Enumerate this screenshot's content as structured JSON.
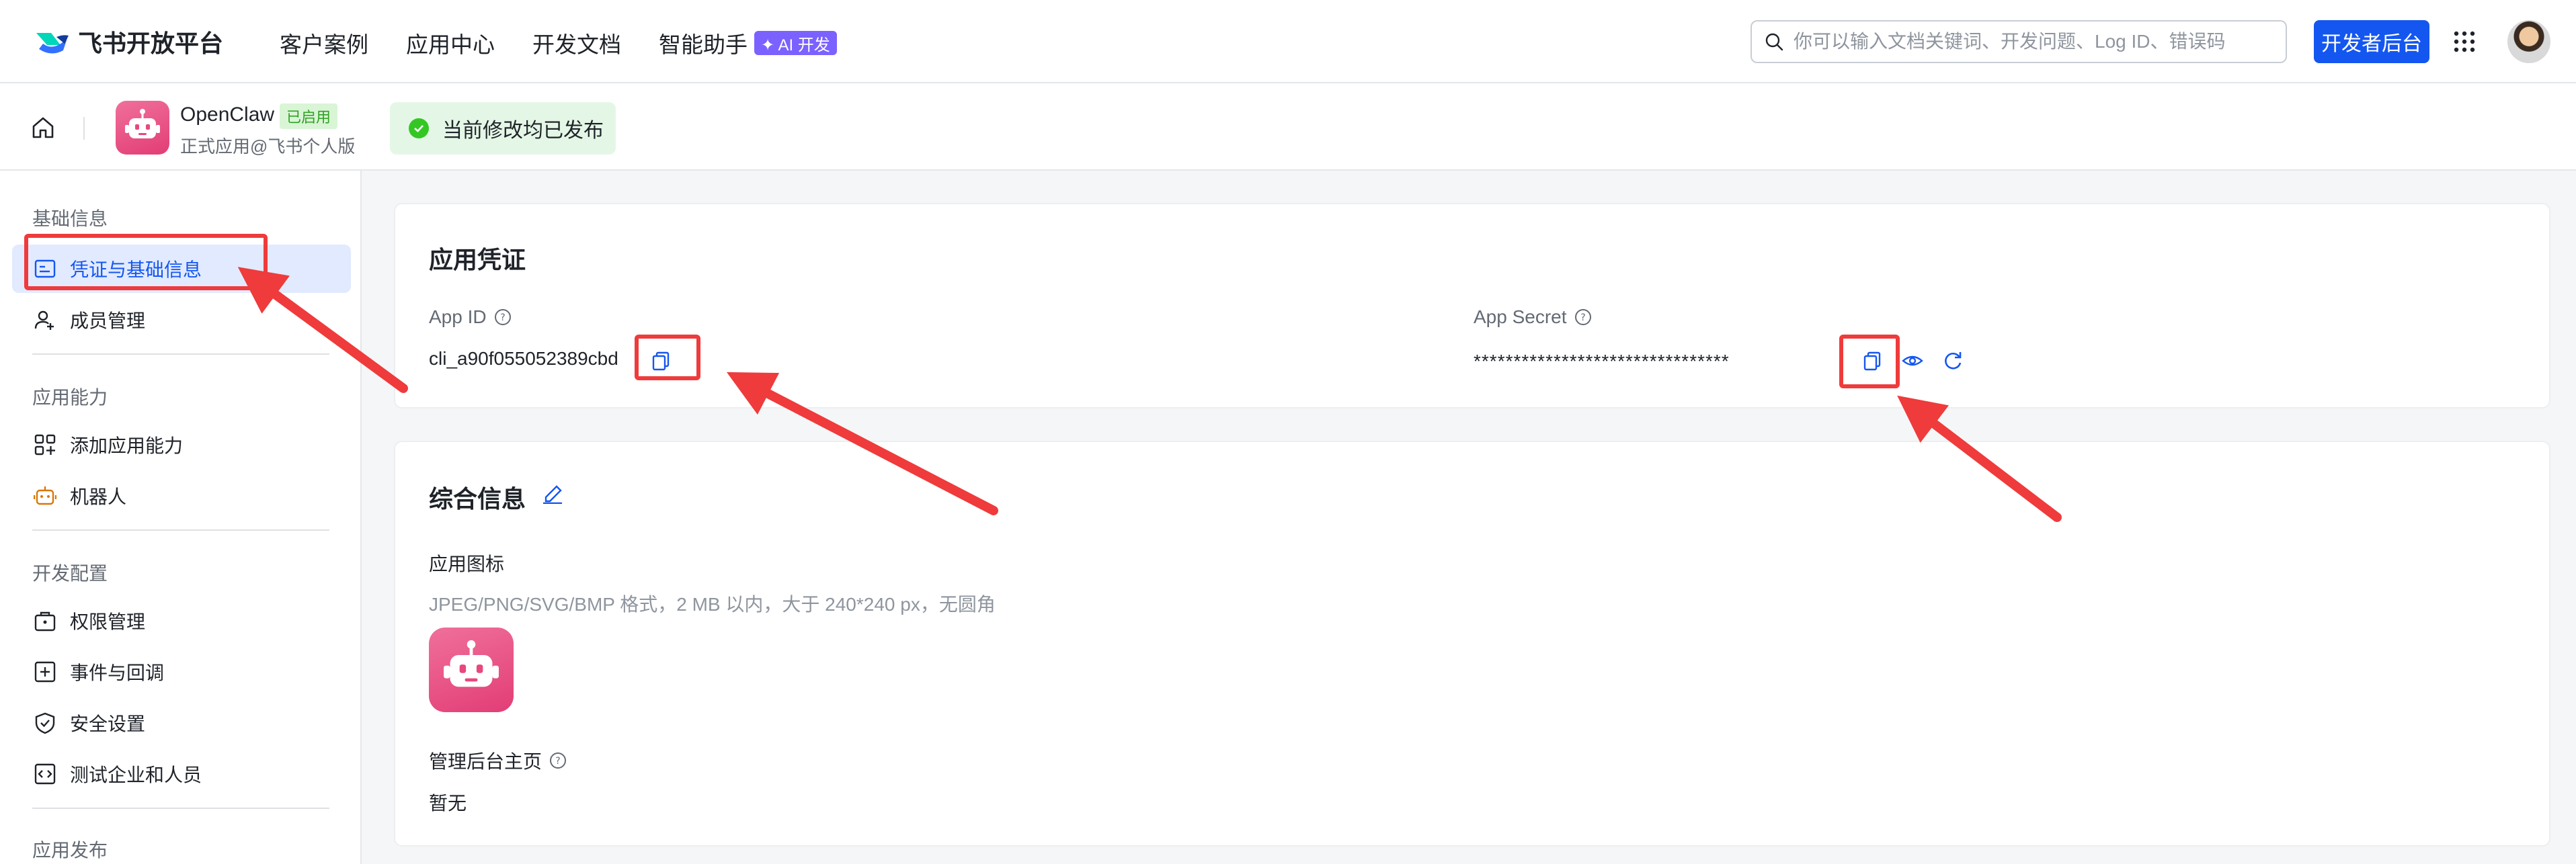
{
  "header": {
    "logo_text": "飞书开放平台",
    "nav": [
      "客户案例",
      "应用中心",
      "开发文档",
      "智能助手"
    ],
    "ai_badge": "✦ AI 开发",
    "search_placeholder": "你可以输入文档关键词、开发问题、Log ID、错误码",
    "dev_console_label": "开发者后台"
  },
  "app_bar": {
    "app_name": "OpenClaw",
    "app_status": "已启用",
    "app_subtitle": "正式应用@飞书个人版",
    "publish_status": "当前修改均已发布"
  },
  "sidebar": {
    "groups": [
      {
        "title": "基础信息",
        "items": [
          {
            "label": "凭证与基础信息",
            "icon": "credential-icon",
            "active": true
          },
          {
            "label": "成员管理",
            "icon": "member-icon"
          }
        ]
      },
      {
        "title": "应用能力",
        "items": [
          {
            "label": "添加应用能力",
            "icon": "add-capability-icon"
          },
          {
            "label": "机器人",
            "icon": "robot-icon"
          }
        ]
      },
      {
        "title": "开发配置",
        "items": [
          {
            "label": "权限管理",
            "icon": "permission-icon"
          },
          {
            "label": "事件与回调",
            "icon": "event-icon"
          },
          {
            "label": "安全设置",
            "icon": "shield-icon"
          },
          {
            "label": "测试企业和人员",
            "icon": "code-icon"
          }
        ]
      },
      {
        "title": "应用发布",
        "items": []
      }
    ]
  },
  "credentials": {
    "title": "应用凭证",
    "app_id_label": "App ID",
    "app_id_value": "cli_a90f055052389cbd",
    "app_secret_label": "App Secret",
    "app_secret_value": "********************************"
  },
  "general": {
    "title": "综合信息",
    "icon_label": "应用图标",
    "icon_hint": "JPEG/PNG/SVG/BMP 格式，2 MB 以内，大于 240*240 px，无圆角",
    "homepage_label": "管理后台主页",
    "homepage_value": "暂无"
  },
  "colors": {
    "primary": "#1456f0",
    "annotation_red": "#ef3b3b",
    "app_icon_pink": "#e8477f",
    "success_green": "#34c724"
  }
}
